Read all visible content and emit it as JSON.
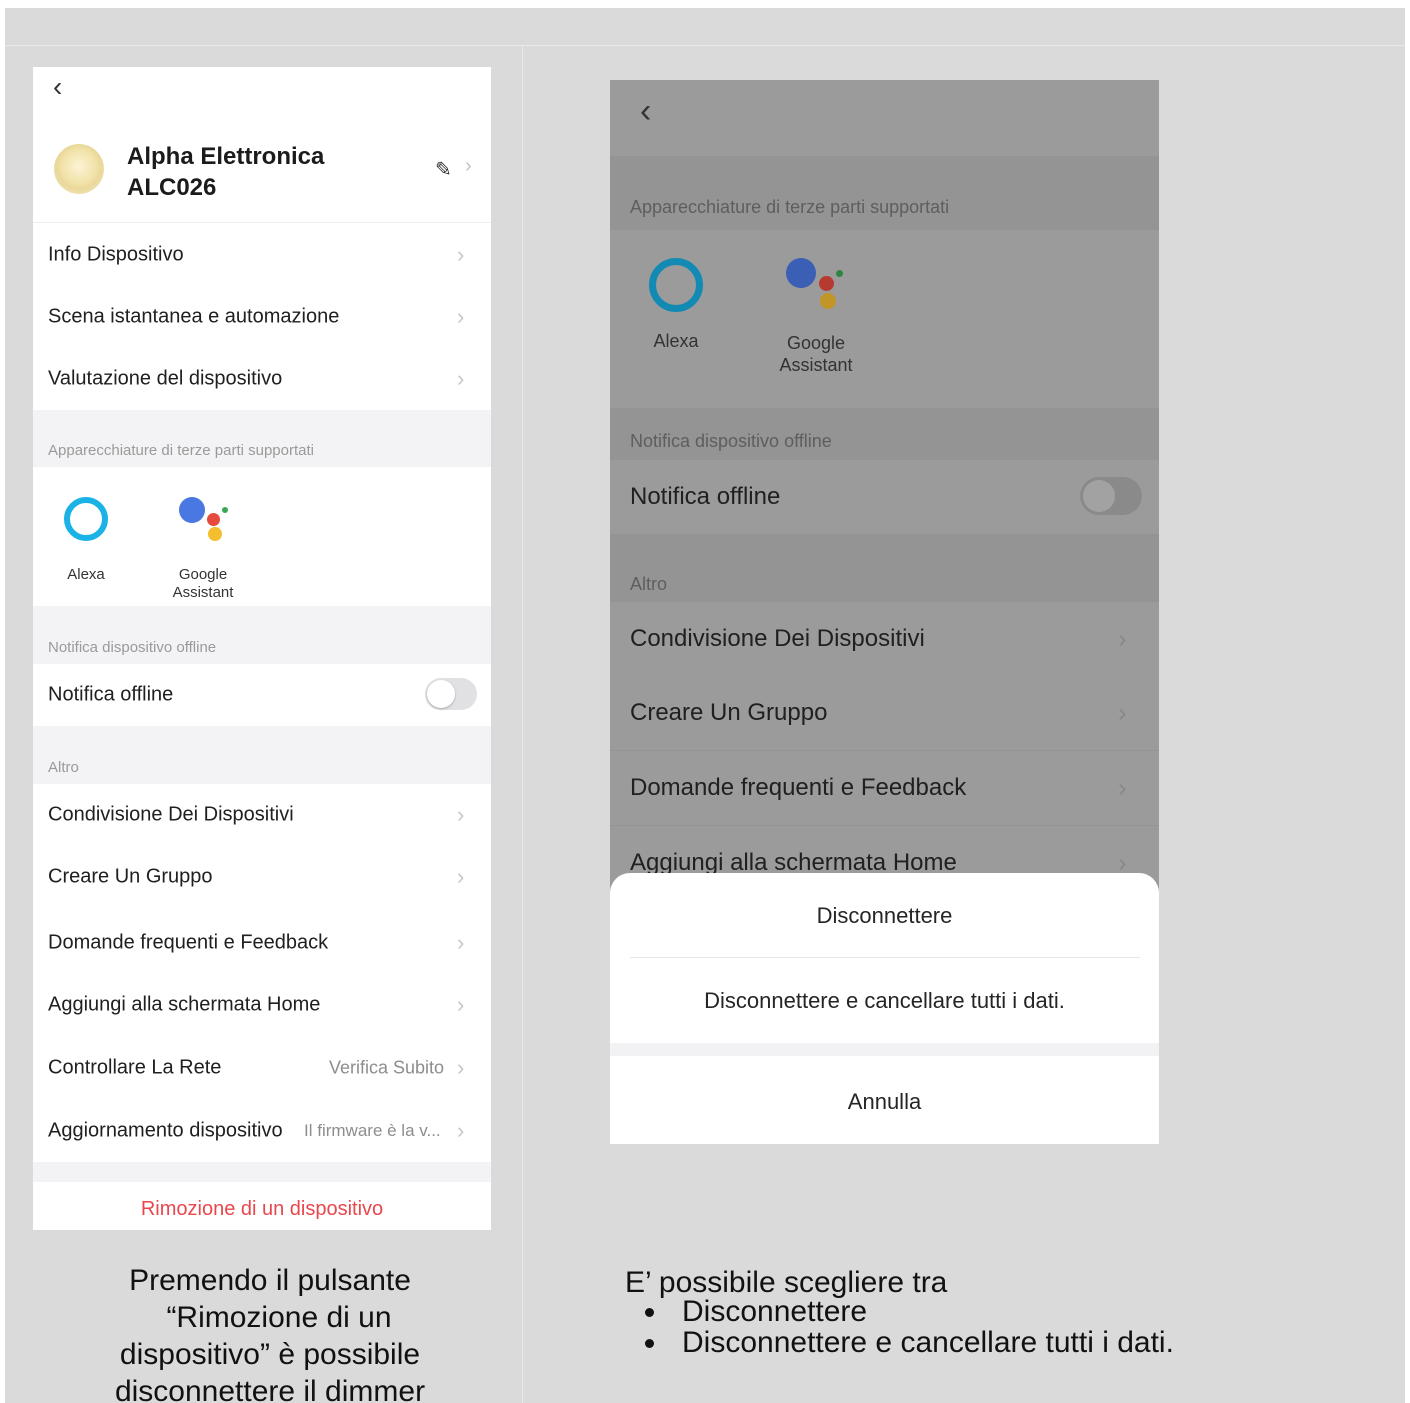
{
  "left_screen": {
    "back_glyph": "‹",
    "device_name_line1": "Alpha Elettronica",
    "device_name_line2": "ALC026",
    "edit_glyph": "✎",
    "chevron": "›",
    "menu_top": [
      {
        "label": "Info Dispositivo"
      },
      {
        "label": "Scena istantanea e automazione"
      },
      {
        "label": "Valutazione del dispositivo"
      }
    ],
    "third_party_section": "Apparecchiature di terze parti supportati",
    "assistants": [
      {
        "label": "Alexa",
        "icon": "alexa-icon"
      },
      {
        "label_line1": "Google",
        "label_line2": "Assistant",
        "icon": "google-assistant-icon"
      }
    ],
    "offline_section": "Notifica dispositivo offline",
    "offline_label": "Notifica offline",
    "offline_toggle_on": false,
    "other_section": "Altro",
    "menu_other": [
      {
        "label": "Condivisione Dei Dispositivi"
      },
      {
        "label": "Creare Un Gruppo"
      },
      {
        "label": "Domande frequenti e Feedback"
      },
      {
        "label": "Aggiungi alla schermata Home"
      },
      {
        "label": "Controllare La Rete",
        "value": "Verifica Subito"
      },
      {
        "label": "Aggiornamento dispositivo",
        "value": "Il firmware è la v..."
      }
    ],
    "remove_label": "Rimozione di un dispositivo",
    "remove_color": "#e8474c"
  },
  "right_screen": {
    "back_glyph": "‹",
    "third_party_section": "Apparecchiature di terze parti supportati",
    "assistants": [
      {
        "label": "Alexa",
        "icon": "alexa-icon"
      },
      {
        "label_line1": "Google",
        "label_line2": "Assistant",
        "icon": "google-assistant-icon"
      }
    ],
    "offline_section": "Notifica dispositivo offline",
    "offline_label": "Notifica offline",
    "offline_toggle_on": false,
    "other_section": "Altro",
    "menu_other": [
      {
        "label": "Condivisione Dei Dispositivi"
      },
      {
        "label": "Creare Un Gruppo"
      },
      {
        "label": "Domande frequenti e Feedback"
      },
      {
        "label": "Aggiungi alla schermata Home"
      }
    ],
    "chevron": "›",
    "action_sheet": {
      "option1": "Disconnettere",
      "option2": "Disconnettere e cancellare tutti i dati.",
      "cancel": "Annulla"
    }
  },
  "caption_left": {
    "line1": "Premendo il pulsante",
    "line2": "“Rimozione di un",
    "line3": "dispositivo” è possibile",
    "line4": "disconnettere il dimmer"
  },
  "caption_right": {
    "intro": "E’ possibile scegliere tra",
    "items": [
      "Disconnettere",
      "Disconnettere e cancellare tutti i dati."
    ]
  },
  "colors": {
    "alexa": "#1bb3e6",
    "google_blue": "#4a78e3",
    "google_red": "#e64a3d",
    "google_yellow": "#f4be2f",
    "google_green": "#38a853"
  }
}
